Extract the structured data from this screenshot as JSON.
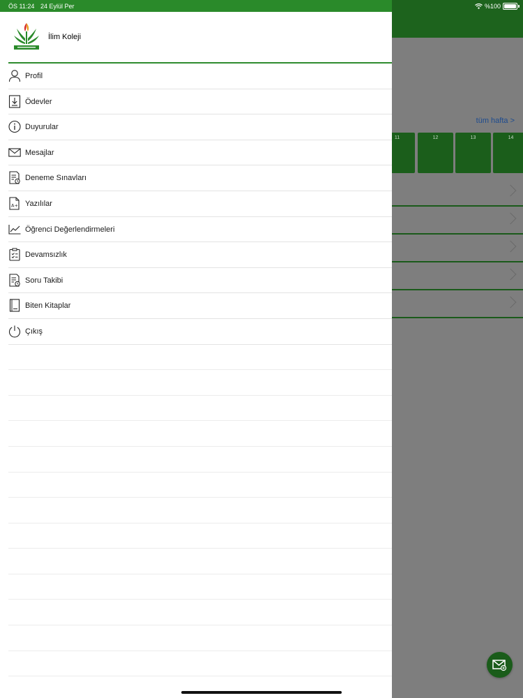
{
  "status_bar": {
    "time": "ÖS 11:24",
    "date": "24 Eylül Per",
    "battery": "%100",
    "wifi_icon": "wifi-icon",
    "battery_icon": "battery-icon"
  },
  "drawer": {
    "school_name": "İlim Koleji",
    "logo_icon": "ilim-koleji-logo",
    "menu_items": [
      {
        "label": "Profil",
        "icon": "person-icon"
      },
      {
        "label": "Ödevler",
        "icon": "download-doc-icon"
      },
      {
        "label": "Duyurular",
        "icon": "info-icon"
      },
      {
        "label": "Mesajlar",
        "icon": "envelope-icon"
      },
      {
        "label": "Deneme Sınavları",
        "icon": "exam-list-icon"
      },
      {
        "label": "Yazılılar",
        "icon": "a-plus-doc-icon"
      },
      {
        "label": "Öğrenci Değerlendirmeleri",
        "icon": "line-chart-icon"
      },
      {
        "label": "Devamsızlık",
        "icon": "clipboard-check-icon"
      },
      {
        "label": "Soru Takibi",
        "icon": "question-list-icon"
      },
      {
        "label": "Biten Kitaplar",
        "icon": "book-icon"
      },
      {
        "label": "Çıkış",
        "icon": "power-icon"
      }
    ]
  },
  "background": {
    "week_link": "tüm hafta >",
    "days": [
      "11",
      "12",
      "13",
      "14"
    ],
    "fab_icon": "mail-icon",
    "colors": {
      "primary_green": "#2a8a2a",
      "dark_green": "#1d631d",
      "link_blue": "#1d4b8f"
    }
  }
}
